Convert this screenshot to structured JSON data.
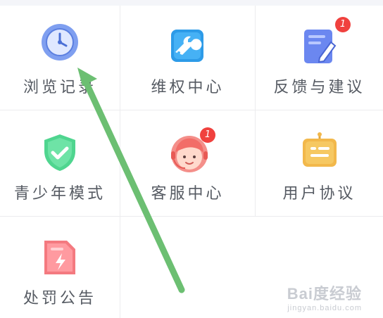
{
  "menu": {
    "items": [
      {
        "label": "浏览记录",
        "icon": "clock-icon",
        "badge": null
      },
      {
        "label": "维权中心",
        "icon": "wrench-icon",
        "badge": null
      },
      {
        "label": "反馈与建议",
        "icon": "feedback-edit-icon",
        "badge": "1"
      },
      {
        "label": "青少年模式",
        "icon": "shield-check-icon",
        "badge": null
      },
      {
        "label": "客服中心",
        "icon": "customer-service-avatar-icon",
        "badge": "1"
      },
      {
        "label": "用户协议",
        "icon": "agreement-board-icon",
        "badge": null
      },
      {
        "label": "处罚公告",
        "icon": "penalty-notice-icon",
        "badge": null
      }
    ]
  },
  "overlay": {
    "arrow_color": "#6cbf72",
    "arrow_target": "浏览记录"
  },
  "watermark": {
    "brand": "Bai度经验",
    "sub": "jingyan.baidu.com"
  },
  "colors": {
    "label": "#555a62",
    "badge": "#f0413e",
    "divider": "#ececee"
  }
}
